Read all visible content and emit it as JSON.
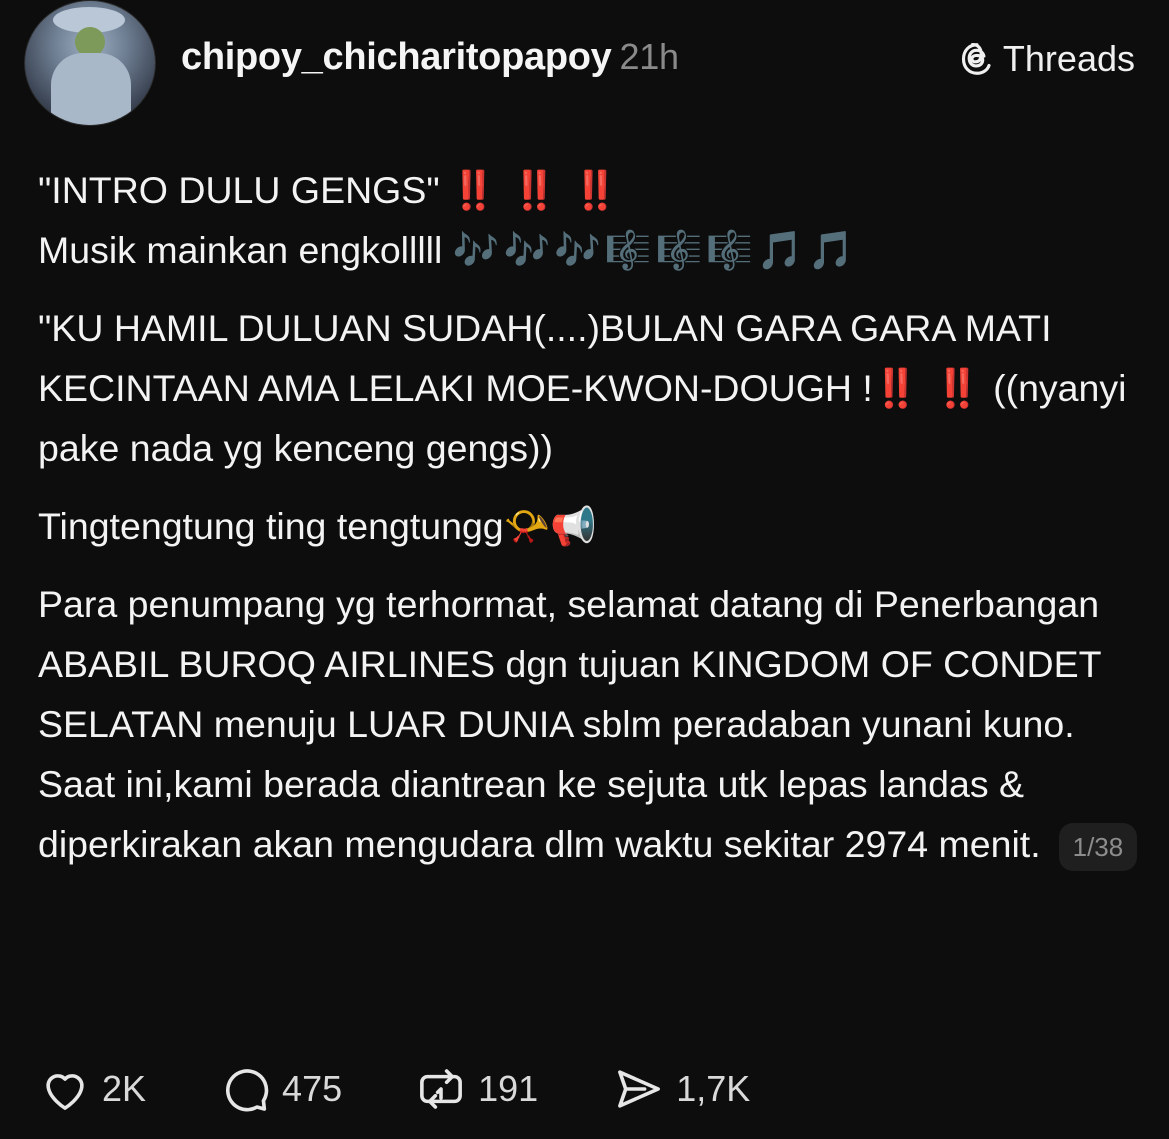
{
  "header": {
    "username": "chipoy_chicharitopapoy",
    "time": "21h",
    "brand": "Threads"
  },
  "post": {
    "line1_text": "\"INTRO DULU GENGS\"",
    "line1_bangs": "‼️ ‼️ ‼️",
    "line2_text": "Musik mainkan engkolllll",
    "line2_emoji": "🎶🎶🎶🎼🎼🎼🎵🎵",
    "para2_text": "\"KU HAMIL DULUAN SUDAH(....)BULAN GARA GARA MATI KECINTAAN AMA LELAKI MOE-KWON-DOUGH !",
    "para2_bangs": "‼️ ‼️",
    "para2_tail": "((nyanyi pake nada yg kenceng  gengs))",
    "para3_text": "Tingtengtung ting tengtungg",
    "para3_emoji": "📯📢",
    "para4_text": "Para penumpang yg terhormat, selamat datang di Penerbangan ABABIL BUROQ AIRLINES dgn tujuan KINGDOM OF CONDET SELATAN menuju LUAR DUNIA sblm peradaban yunani kuno.",
    "para5_text": "Saat ini,kami berada diantrean ke sejuta utk lepas landas & diperkirakan akan mengudara dlm waktu sekitar 2974 menit.",
    "counter": "1/38"
  },
  "actions": {
    "likes": "2K",
    "comments": "475",
    "reposts": "191",
    "shares": "1,7K"
  },
  "icons": [
    "avatar",
    "threads-logo-icon",
    "heart-icon",
    "comment-icon",
    "repost-icon",
    "share-icon"
  ],
  "colors": {
    "background": "#0d0d0d",
    "text": "#f3f3f3",
    "muted": "#8a8a8a",
    "exclaim": "#e31b1b"
  }
}
